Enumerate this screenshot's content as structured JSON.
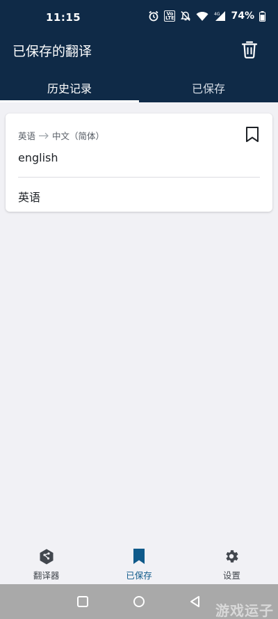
{
  "status_bar": {
    "time": "11:15",
    "volte_label": "Vo LTE",
    "network": "4G",
    "battery": "74%"
  },
  "header": {
    "title": "已保存的翻译",
    "tabs": [
      {
        "label": "历史记录",
        "active": true
      },
      {
        "label": "已保存",
        "active": false
      }
    ]
  },
  "card": {
    "source_lang": "英语",
    "target_lang": "中文（简体）",
    "source_text": "english",
    "target_text": "英语"
  },
  "bottom_nav": {
    "items": [
      {
        "label": "翻译器",
        "icon": "deepl-logo-icon",
        "active": false
      },
      {
        "label": "已保存",
        "icon": "bookmark-icon",
        "active": true
      },
      {
        "label": "设置",
        "icon": "gear-icon",
        "active": false
      }
    ]
  },
  "watermark": "游戏运子",
  "colors": {
    "header_bg": "#0f2a47",
    "page_bg": "#f1f1f5",
    "accent": "#0f5a8a"
  }
}
